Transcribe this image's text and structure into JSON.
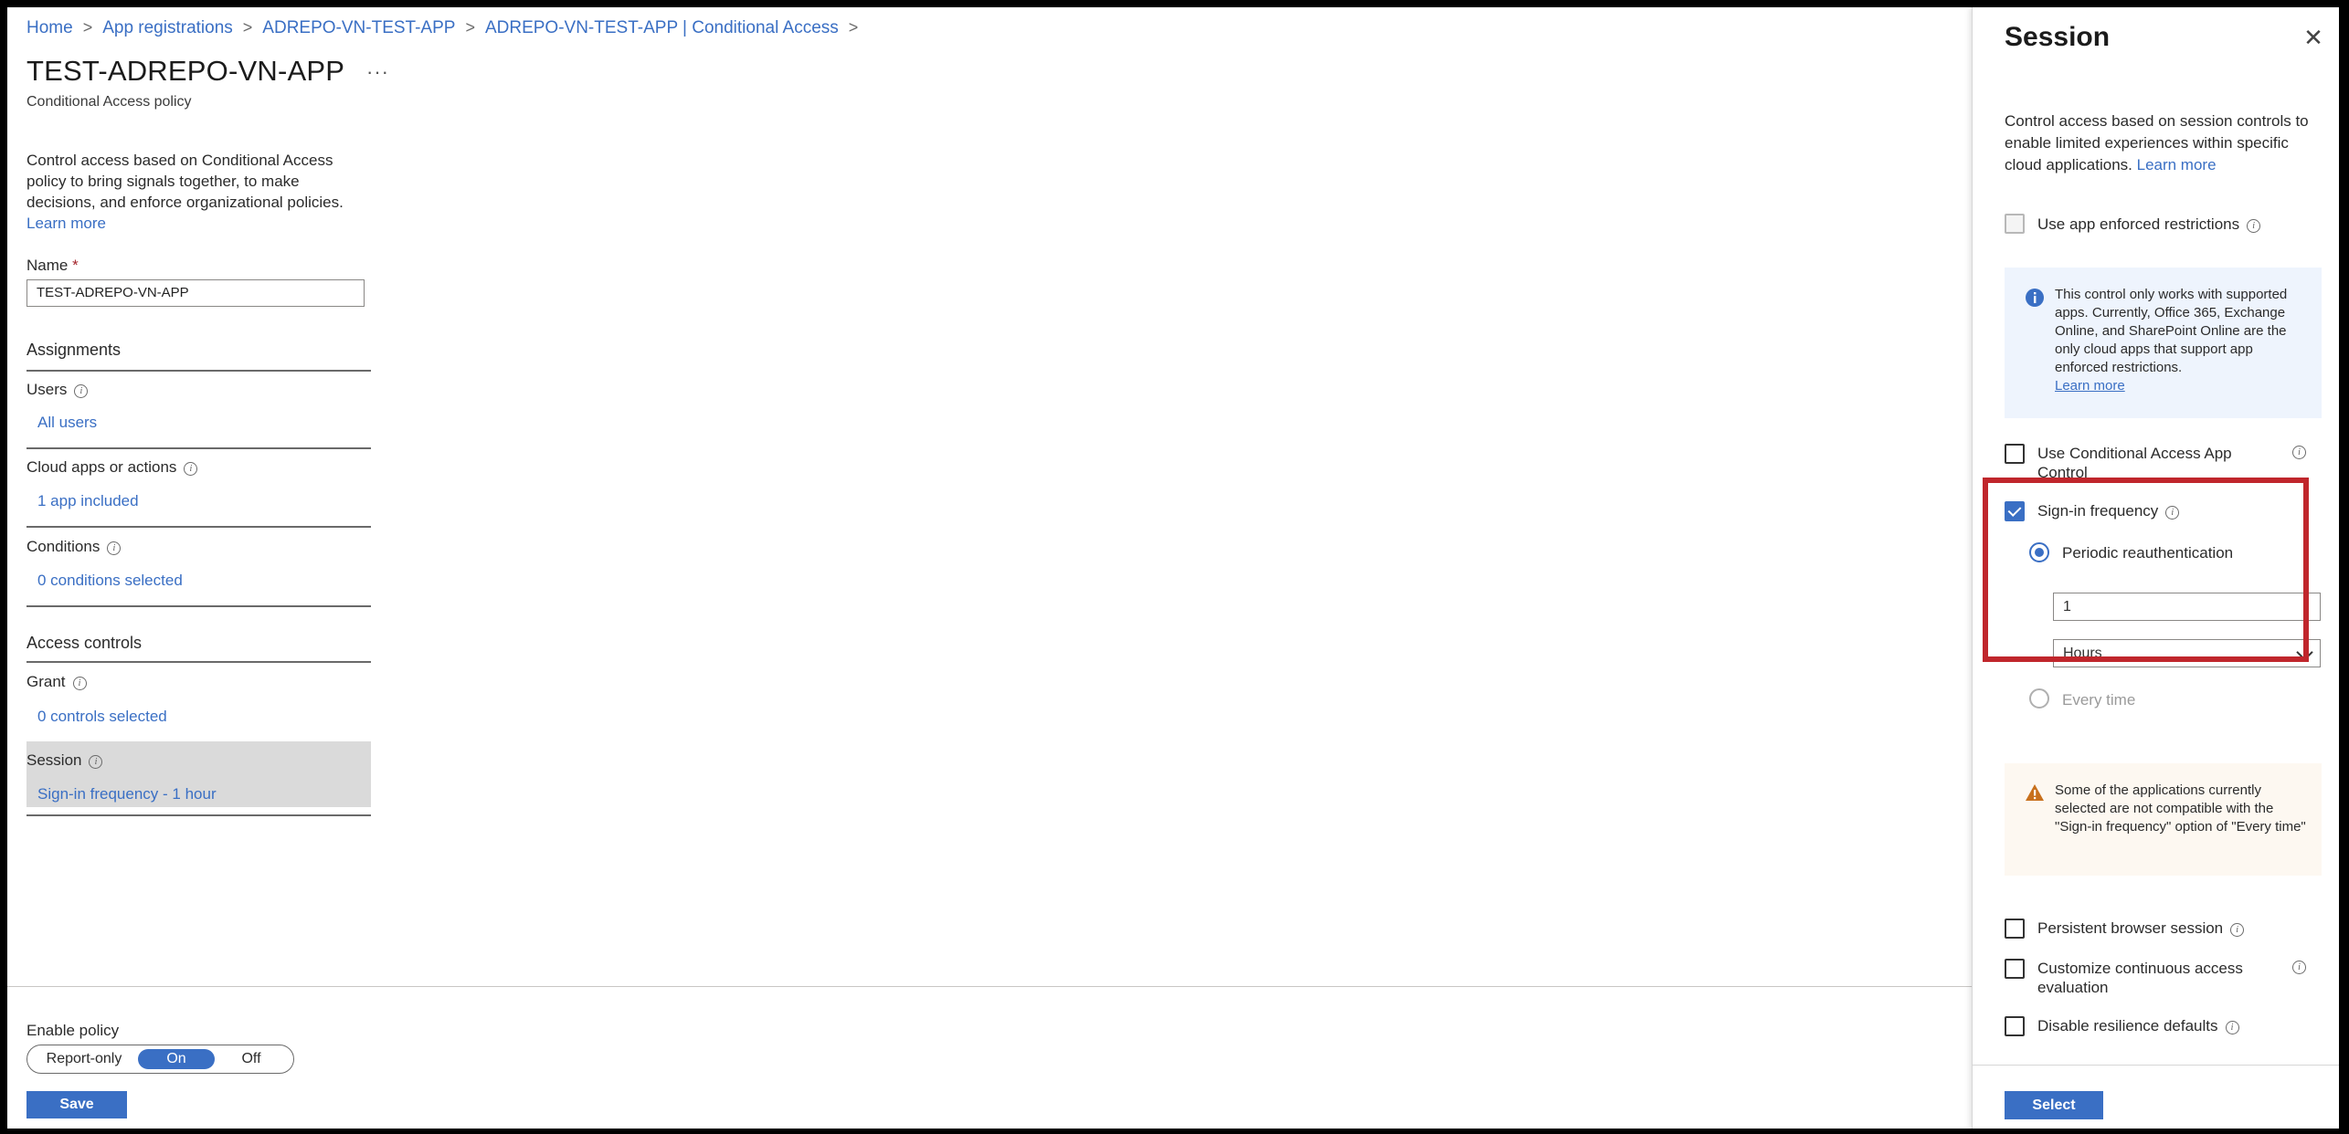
{
  "breadcrumb": [
    {
      "label": "Home"
    },
    {
      "label": "App registrations"
    },
    {
      "label": "ADREPO-VN-TEST-APP"
    },
    {
      "label": "ADREPO-VN-TEST-APP | Conditional Access"
    }
  ],
  "page": {
    "title": "TEST-ADREPO-VN-APP",
    "more_label": "···",
    "subtitle": "Conditional Access policy",
    "description": "Control access based on Conditional Access policy to bring signals together, to make decisions, and enforce organizational policies.",
    "learn_more": "Learn more"
  },
  "name_field": {
    "label": "Name",
    "required_mark": "*",
    "value": "TEST-ADREPO-VN-APP"
  },
  "assignments": {
    "heading": "Assignments",
    "users": {
      "label": "Users",
      "value": "All users"
    },
    "cloud_apps": {
      "label": "Cloud apps or actions",
      "value": "1 app included"
    },
    "conditions": {
      "label": "Conditions",
      "value": "0 conditions selected"
    }
  },
  "access_controls": {
    "heading": "Access controls",
    "grant": {
      "label": "Grant",
      "value": "0 controls selected"
    },
    "session": {
      "label": "Session",
      "value": "Sign-in frequency - 1 hour"
    }
  },
  "enable_policy": {
    "label": "Enable policy",
    "options": [
      "Report-only",
      "On",
      "Off"
    ],
    "selected": "On"
  },
  "save_label": "Save",
  "panel": {
    "title": "Session",
    "close_label": "✕",
    "description": "Control access based on session controls to enable limited experiences within specific cloud applications.",
    "learn_more": "Learn more",
    "app_enforced": {
      "label": "Use app enforced restrictions",
      "checked": false,
      "disabled": true
    },
    "info_box": {
      "text": "This control only works with supported apps. Currently, Office 365, Exchange Online, and SharePoint Online are the only cloud apps that support app enforced restrictions.",
      "link": "Learn more"
    },
    "ca_app_control": {
      "label": "Use Conditional Access App Control",
      "checked": false
    },
    "sign_in_frequency": {
      "label": "Sign-in frequency",
      "checked": true,
      "periodic_label": "Periodic reauthentication",
      "value": "1",
      "unit": "Hours",
      "every_time_label": "Every time"
    },
    "warning_box": {
      "text": "Some of the applications currently selected are not compatible with the \"Sign-in frequency\" option of \"Every time\""
    },
    "persistent_browser": {
      "label": "Persistent browser session",
      "checked": false
    },
    "continuous_access": {
      "label": "Customize continuous access evaluation",
      "checked": false
    },
    "resilience": {
      "label": "Disable resilience defaults",
      "checked": false
    },
    "select_label": "Select"
  },
  "colors": {
    "accent": "#3a6fc4",
    "highlight": "#c0262c",
    "warning": "#c8701c",
    "info_icon": "#3a6fc4"
  }
}
